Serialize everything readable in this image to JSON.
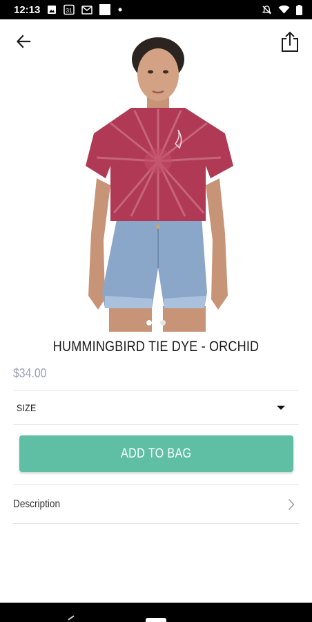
{
  "status_bar": {
    "time": "12:13",
    "icons": [
      "image-icon",
      "calendar-31-icon",
      "gmail-icon",
      "square-icon",
      "dot-icon",
      "silent-bell-icon",
      "wifi-icon",
      "battery-icon"
    ],
    "calendar_day": "31"
  },
  "toolbar": {
    "back_icon": "arrow-left-icon",
    "share_icon": "share-icon"
  },
  "gallery": {
    "dots_count": 2,
    "active_dot": 0,
    "shirt_color": "#b03a55",
    "shorts_color": "#8aa7c9"
  },
  "product": {
    "title": "HUMMINGBIRD TIE DYE - ORCHID",
    "price": "$34.00",
    "price_color": "#9a9fb7"
  },
  "size_selector": {
    "label": "SIZE",
    "icon": "caret-down-icon"
  },
  "cta": {
    "label": "ADD TO BAG",
    "color": "#5fbfa5"
  },
  "description": {
    "label": "Description",
    "icon": "chevron-right-icon"
  }
}
